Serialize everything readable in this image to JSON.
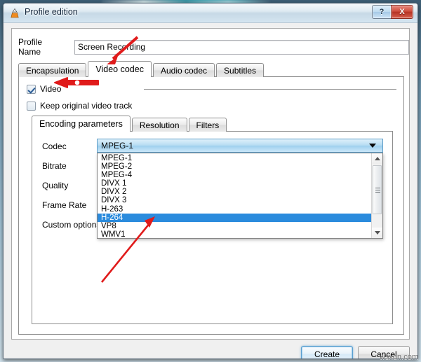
{
  "window": {
    "title": "Profile edition",
    "app_icon": "vlc-cone-icon",
    "help_label": "?",
    "close_label": "X"
  },
  "profile": {
    "label": "Profile Name",
    "value": "Screen Recording",
    "placeholder": ""
  },
  "outer_tabs": [
    {
      "label": "Encapsulation",
      "active": false
    },
    {
      "label": "Video codec",
      "active": true
    },
    {
      "label": "Audio codec",
      "active": false
    },
    {
      "label": "Subtitles",
      "active": false
    }
  ],
  "checkboxes": [
    {
      "label": "Video",
      "checked": true
    },
    {
      "label": "Keep original video track",
      "checked": false
    }
  ],
  "inner_tabs": [
    {
      "label": "Encoding parameters",
      "active": true
    },
    {
      "label": "Resolution",
      "active": false
    },
    {
      "label": "Filters",
      "active": false
    }
  ],
  "fields": [
    {
      "label": "Codec"
    },
    {
      "label": "Bitrate"
    },
    {
      "label": "Quality"
    },
    {
      "label": "Frame Rate"
    },
    {
      "label": "Custom options"
    }
  ],
  "codec_combo": {
    "selected": "MPEG-1",
    "expanded": true,
    "highlighted": "H-264",
    "options": [
      "MPEG-1",
      "MPEG-2",
      "MPEG-4",
      "DIVX 1",
      "DIVX 2",
      "DIVX 3",
      "H-263",
      "H-264",
      "VP8",
      "WMV1"
    ]
  },
  "scrollbar": {
    "up_icon": "triangle-up-icon",
    "down_icon": "triangle-down-icon",
    "grip_icon": "grip-lines-icon"
  },
  "buttons": {
    "create": "Create",
    "cancel": "Cancel"
  },
  "watermark": "wsxdn.com",
  "colors": {
    "annotation_red": "#e01b1b",
    "selection_blue": "#2a8bdd",
    "combo_blue": "#9ed0ee",
    "close_red": "#cf4f3e"
  }
}
